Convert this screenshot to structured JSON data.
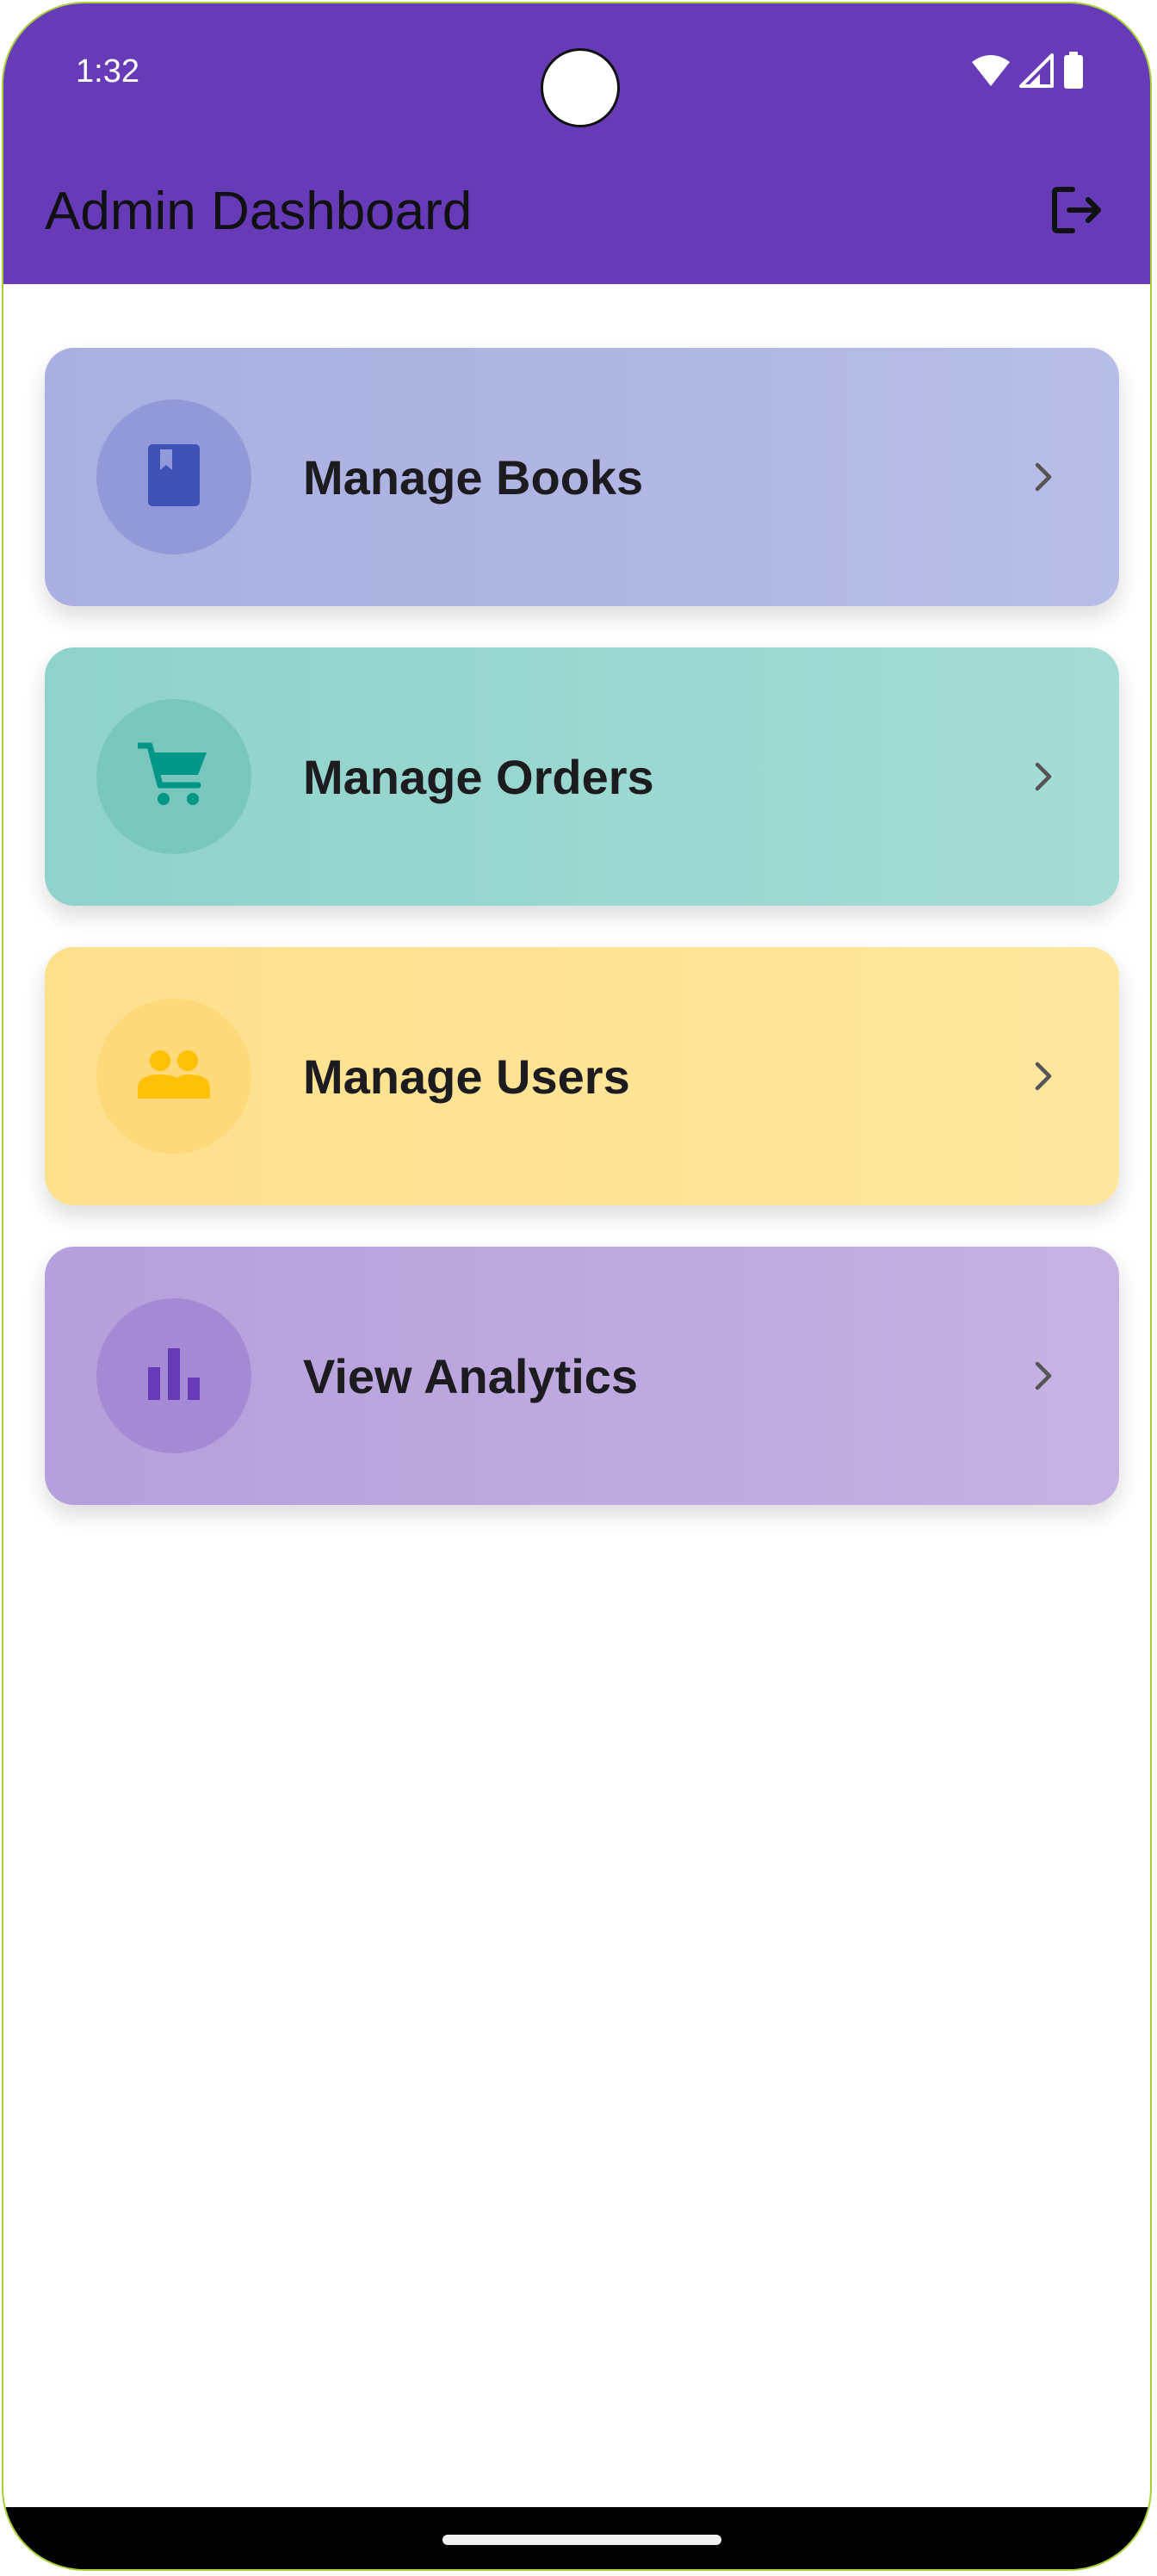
{
  "status_bar": {
    "time": "1:32",
    "icons": [
      "wifi-icon",
      "signal-icon",
      "battery-icon"
    ]
  },
  "app_bar": {
    "title": "Admin Dashboard",
    "action_icon": "logout-icon",
    "background_color": "#673ab7"
  },
  "menu": {
    "items": [
      {
        "label": "Manage Books",
        "icon": "book-icon",
        "color": "#3f51b5"
      },
      {
        "label": "Manage Orders",
        "icon": "cart-icon",
        "color": "#009688"
      },
      {
        "label": "Manage Users",
        "icon": "people-icon",
        "color": "#ffc107"
      },
      {
        "label": "View Analytics",
        "icon": "bar-chart-icon",
        "color": "#673ab7"
      }
    ]
  }
}
